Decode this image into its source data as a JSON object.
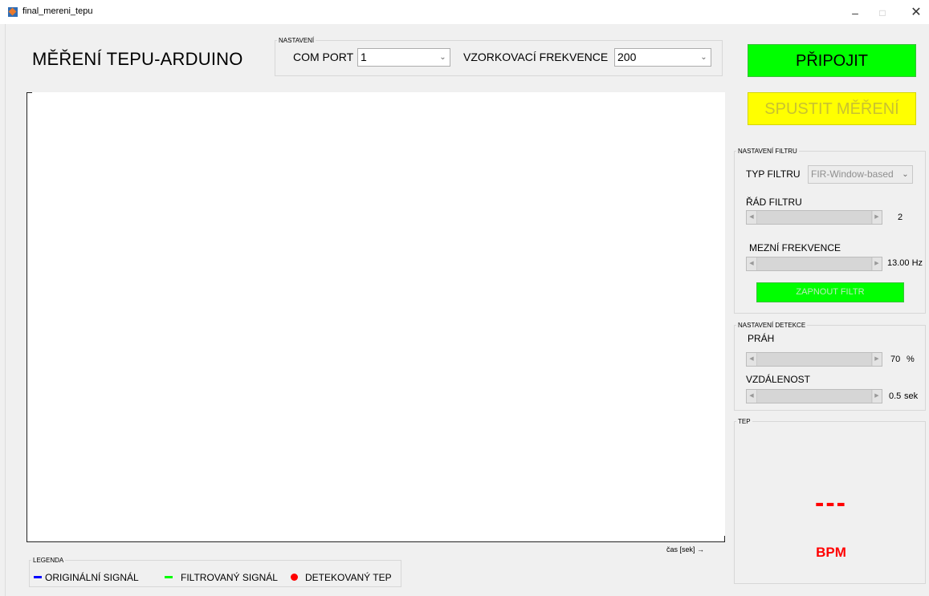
{
  "window": {
    "title": "final_mereni_tepu",
    "minimize": "–",
    "maximize": "□",
    "close": "✕"
  },
  "app": {
    "heading": "MĚŘENÍ TEPU-ARDUINO"
  },
  "settings": {
    "legend": "NASTAVENÍ",
    "com_port_label": "COM PORT",
    "com_port_value": "1",
    "sample_rate_label": "VZORKOVACÍ FREKVENCE",
    "sample_rate_value": "200"
  },
  "buttons": {
    "connect": "PŘIPOJIT",
    "start": "SPUSTIT MĚŘENÍ",
    "filter_on": "ZAPNOUT FILTR"
  },
  "plot": {
    "x_label": "čas [sek] →"
  },
  "legend": {
    "title": "LEGENDA",
    "items": [
      {
        "label": "ORIGINÁLNÍ SIGNÁL",
        "color": "#0000ff"
      },
      {
        "label": "FILTROVANÝ SIGNÁL",
        "color": "#00ff00"
      },
      {
        "label": "DETEKOVANÝ TEP",
        "color": "#ff0000"
      }
    ]
  },
  "filter": {
    "legend": "NASTAVENÍ FILTRU",
    "type_label": "TYP FILTRU",
    "type_value": "FIR-Window-based",
    "order_label": "ŘÁD FILTRU",
    "order_value": "2",
    "cutoff_label": "MEZNÍ FREKVENCE",
    "cutoff_value": "13.00 Hz"
  },
  "detection": {
    "legend": "NASTAVENÍ DETEKCE",
    "threshold_label": "PRÁH",
    "threshold_value": "70",
    "threshold_unit": "%",
    "distance_label": "VZDÁLENOST",
    "distance_value": "0.5",
    "distance_unit": "sek"
  },
  "heart_rate": {
    "legend": "TEP",
    "value": "---",
    "unit": "BPM"
  }
}
